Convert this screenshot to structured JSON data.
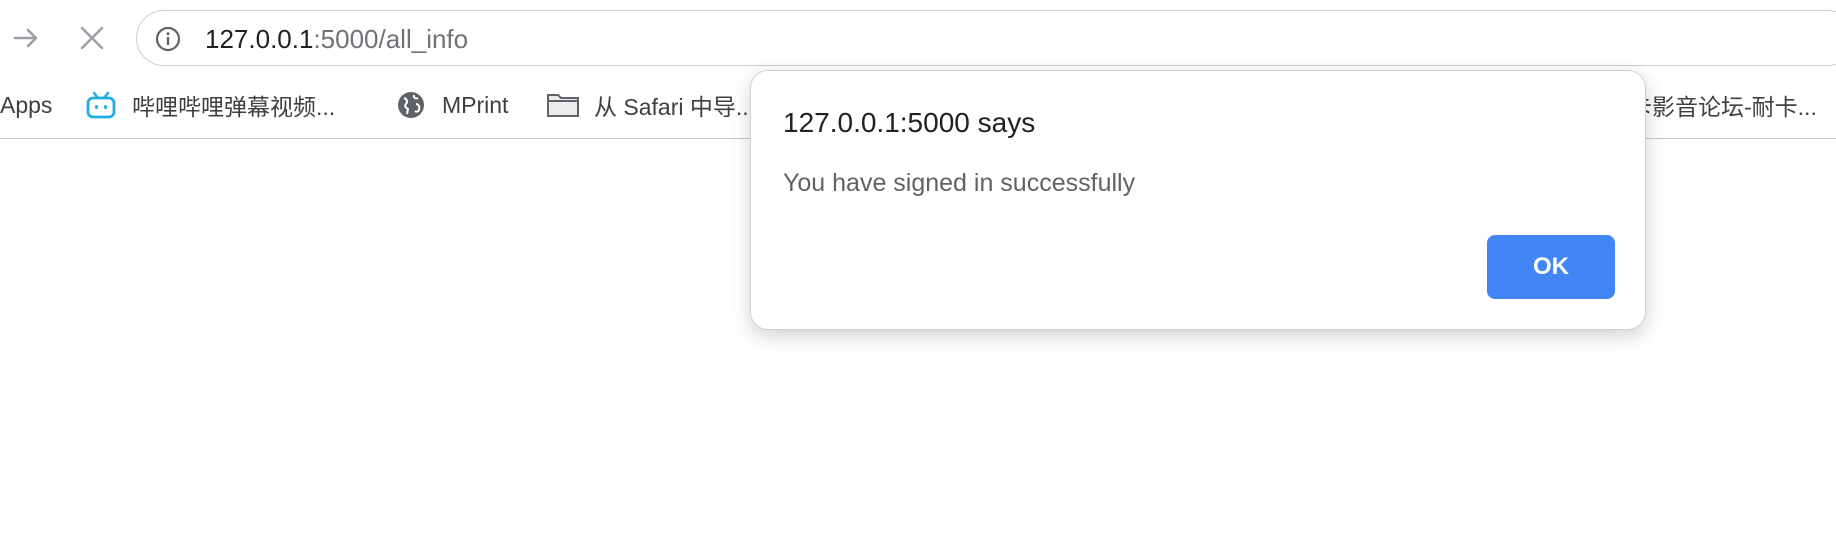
{
  "nav": {
    "forward_icon": "arrow-right-icon",
    "stop_icon": "close-icon"
  },
  "omnibox": {
    "info_icon": "info-icon",
    "url_host": "127.0.0.1",
    "url_rest": ":5000/all_info"
  },
  "bookmarks": [
    {
      "label": "Apps",
      "icon": "apps-grid-icon"
    },
    {
      "label": "哔哩哔哩弹幕视频...",
      "icon": "bilibili-icon"
    },
    {
      "label": "MPrint",
      "icon": "globe-icon"
    },
    {
      "label": "从 Safari 中导...",
      "icon": "folder-icon"
    },
    {
      "label": "…卡影音论坛-耐卡...",
      "icon": ""
    }
  ],
  "dialog": {
    "title": "127.0.0.1:5000 says",
    "message": "You have signed in successfully",
    "ok_label": "OK"
  },
  "colors": {
    "accent": "#4285f4",
    "bilibili": "#23ade5"
  }
}
